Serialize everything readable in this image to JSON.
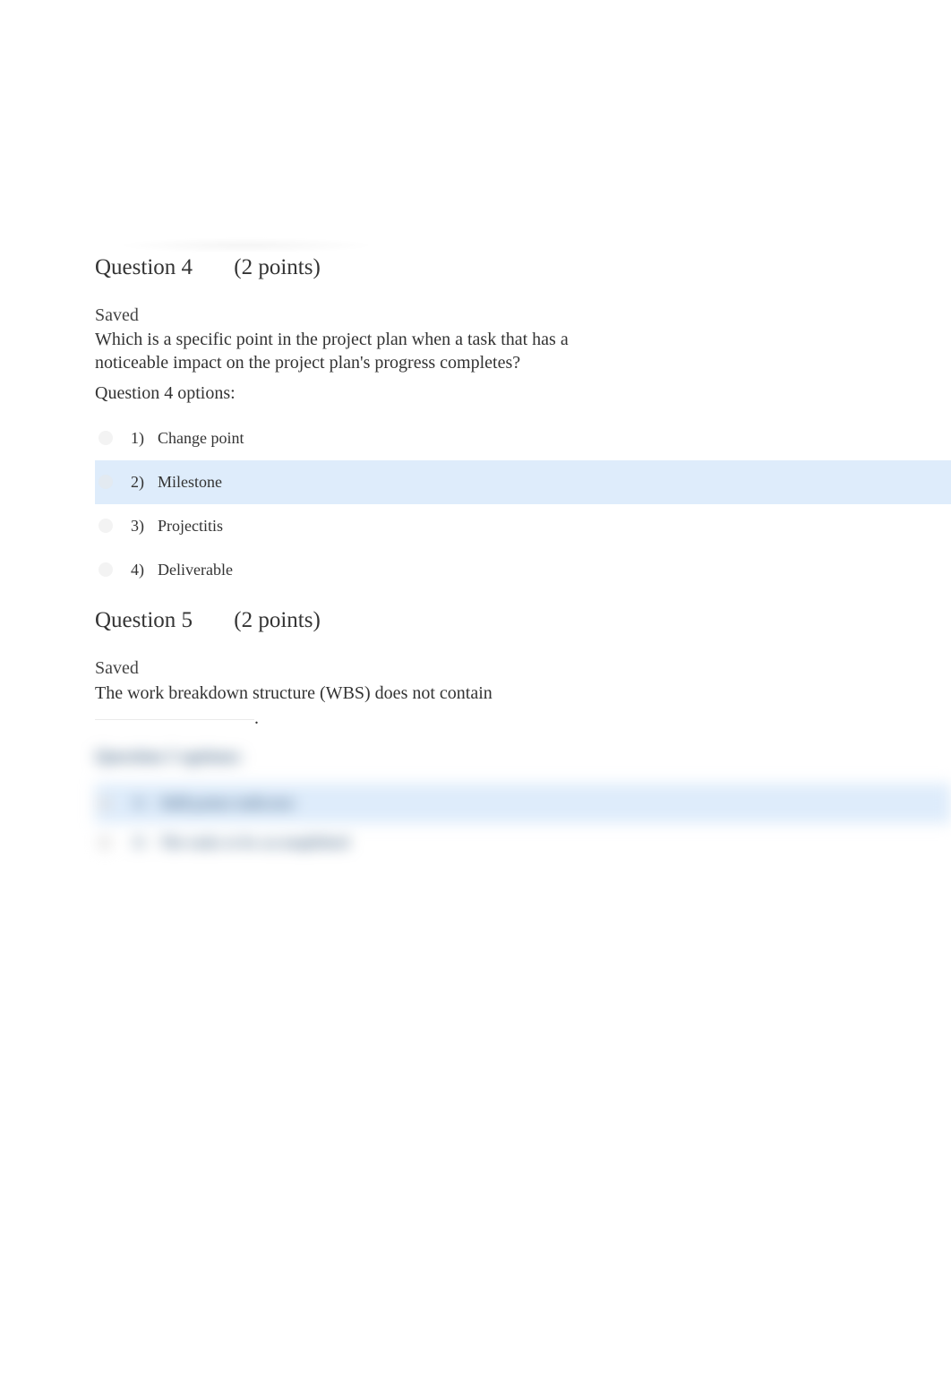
{
  "q4": {
    "header_label": "Question 4",
    "header_points": "(2 points)",
    "saved": "Saved",
    "text": "Which is a specific point in the project plan when a task that has a noticeable impact on the project plan's progress completes?",
    "options_label": "Question 4 options:",
    "options": [
      {
        "num": "1)",
        "text": "Change point"
      },
      {
        "num": "2)",
        "text": "Milestone"
      },
      {
        "num": "3)",
        "text": "Projectitis"
      },
      {
        "num": "4)",
        "text": "Deliverable"
      }
    ]
  },
  "q5": {
    "header_label": "Question 5",
    "header_points": "(2 points)",
    "saved": "Saved",
    "text_before": "The work breakdown structure (WBS) does not contain ",
    "text_after": ".",
    "options_label": "Question 5 options:",
    "options": [
      {
        "num": "1)",
        "text": "Skill points indicator"
      },
      {
        "num": "2)",
        "text": "The tasks to be accomplished"
      }
    ]
  }
}
